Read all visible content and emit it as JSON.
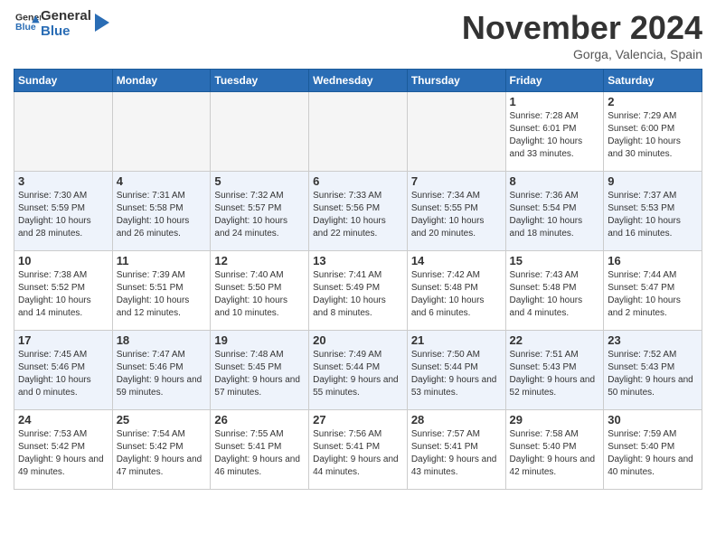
{
  "header": {
    "logo_general": "General",
    "logo_blue": "Blue",
    "month_title": "November 2024",
    "location": "Gorga, Valencia, Spain"
  },
  "weekdays": [
    "Sunday",
    "Monday",
    "Tuesday",
    "Wednesday",
    "Thursday",
    "Friday",
    "Saturday"
  ],
  "weeks": [
    [
      {
        "day": "",
        "empty": true
      },
      {
        "day": "",
        "empty": true
      },
      {
        "day": "",
        "empty": true
      },
      {
        "day": "",
        "empty": true
      },
      {
        "day": "",
        "empty": true
      },
      {
        "day": "1",
        "sunrise": "7:28 AM",
        "sunset": "6:01 PM",
        "daylight": "10 hours and 33 minutes."
      },
      {
        "day": "2",
        "sunrise": "7:29 AM",
        "sunset": "6:00 PM",
        "daylight": "10 hours and 30 minutes."
      }
    ],
    [
      {
        "day": "3",
        "sunrise": "7:30 AM",
        "sunset": "5:59 PM",
        "daylight": "10 hours and 28 minutes."
      },
      {
        "day": "4",
        "sunrise": "7:31 AM",
        "sunset": "5:58 PM",
        "daylight": "10 hours and 26 minutes."
      },
      {
        "day": "5",
        "sunrise": "7:32 AM",
        "sunset": "5:57 PM",
        "daylight": "10 hours and 24 minutes."
      },
      {
        "day": "6",
        "sunrise": "7:33 AM",
        "sunset": "5:56 PM",
        "daylight": "10 hours and 22 minutes."
      },
      {
        "day": "7",
        "sunrise": "7:34 AM",
        "sunset": "5:55 PM",
        "daylight": "10 hours and 20 minutes."
      },
      {
        "day": "8",
        "sunrise": "7:36 AM",
        "sunset": "5:54 PM",
        "daylight": "10 hours and 18 minutes."
      },
      {
        "day": "9",
        "sunrise": "7:37 AM",
        "sunset": "5:53 PM",
        "daylight": "10 hours and 16 minutes."
      }
    ],
    [
      {
        "day": "10",
        "sunrise": "7:38 AM",
        "sunset": "5:52 PM",
        "daylight": "10 hours and 14 minutes."
      },
      {
        "day": "11",
        "sunrise": "7:39 AM",
        "sunset": "5:51 PM",
        "daylight": "10 hours and 12 minutes."
      },
      {
        "day": "12",
        "sunrise": "7:40 AM",
        "sunset": "5:50 PM",
        "daylight": "10 hours and 10 minutes."
      },
      {
        "day": "13",
        "sunrise": "7:41 AM",
        "sunset": "5:49 PM",
        "daylight": "10 hours and 8 minutes."
      },
      {
        "day": "14",
        "sunrise": "7:42 AM",
        "sunset": "5:48 PM",
        "daylight": "10 hours and 6 minutes."
      },
      {
        "day": "15",
        "sunrise": "7:43 AM",
        "sunset": "5:48 PM",
        "daylight": "10 hours and 4 minutes."
      },
      {
        "day": "16",
        "sunrise": "7:44 AM",
        "sunset": "5:47 PM",
        "daylight": "10 hours and 2 minutes."
      }
    ],
    [
      {
        "day": "17",
        "sunrise": "7:45 AM",
        "sunset": "5:46 PM",
        "daylight": "10 hours and 0 minutes."
      },
      {
        "day": "18",
        "sunrise": "7:47 AM",
        "sunset": "5:46 PM",
        "daylight": "9 hours and 59 minutes."
      },
      {
        "day": "19",
        "sunrise": "7:48 AM",
        "sunset": "5:45 PM",
        "daylight": "9 hours and 57 minutes."
      },
      {
        "day": "20",
        "sunrise": "7:49 AM",
        "sunset": "5:44 PM",
        "daylight": "9 hours and 55 minutes."
      },
      {
        "day": "21",
        "sunrise": "7:50 AM",
        "sunset": "5:44 PM",
        "daylight": "9 hours and 53 minutes."
      },
      {
        "day": "22",
        "sunrise": "7:51 AM",
        "sunset": "5:43 PM",
        "daylight": "9 hours and 52 minutes."
      },
      {
        "day": "23",
        "sunrise": "7:52 AM",
        "sunset": "5:43 PM",
        "daylight": "9 hours and 50 minutes."
      }
    ],
    [
      {
        "day": "24",
        "sunrise": "7:53 AM",
        "sunset": "5:42 PM",
        "daylight": "9 hours and 49 minutes."
      },
      {
        "day": "25",
        "sunrise": "7:54 AM",
        "sunset": "5:42 PM",
        "daylight": "9 hours and 47 minutes."
      },
      {
        "day": "26",
        "sunrise": "7:55 AM",
        "sunset": "5:41 PM",
        "daylight": "9 hours and 46 minutes."
      },
      {
        "day": "27",
        "sunrise": "7:56 AM",
        "sunset": "5:41 PM",
        "daylight": "9 hours and 44 minutes."
      },
      {
        "day": "28",
        "sunrise": "7:57 AM",
        "sunset": "5:41 PM",
        "daylight": "9 hours and 43 minutes."
      },
      {
        "day": "29",
        "sunrise": "7:58 AM",
        "sunset": "5:40 PM",
        "daylight": "9 hours and 42 minutes."
      },
      {
        "day": "30",
        "sunrise": "7:59 AM",
        "sunset": "5:40 PM",
        "daylight": "9 hours and 40 minutes."
      }
    ]
  ]
}
